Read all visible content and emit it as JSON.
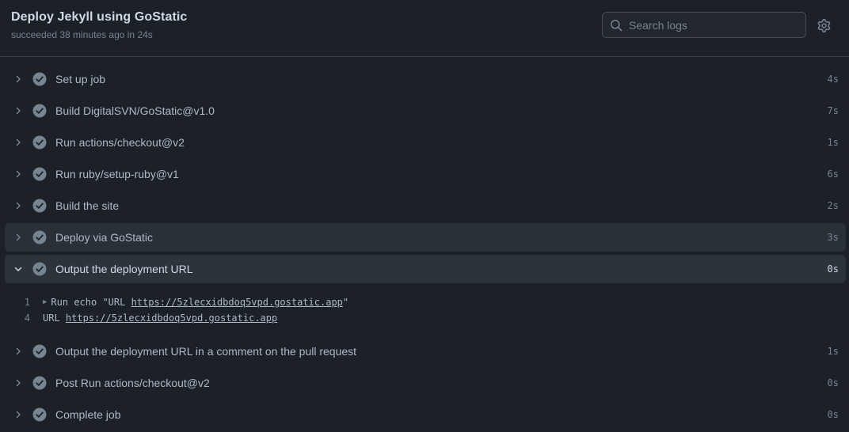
{
  "header": {
    "title": "Deploy Jekyll using GoStatic",
    "subtitle": "succeeded 38 minutes ago in 24s",
    "search_placeholder": "Search logs"
  },
  "colors": {
    "success": "#768390",
    "background": "#1c2128",
    "text": "#adbac7"
  },
  "steps_before": [
    {
      "name": "Set up job",
      "duration": "4s"
    },
    {
      "name": "Build DigitalSVN/GoStatic@v1.0",
      "duration": "7s"
    },
    {
      "name": "Run actions/checkout@v2",
      "duration": "1s"
    },
    {
      "name": "Run ruby/setup-ruby@v1",
      "duration": "6s"
    },
    {
      "name": "Build the site",
      "duration": "2s"
    },
    {
      "name": "Deploy via GoStatic",
      "duration": "3s"
    }
  ],
  "expanded_step": {
    "name": "Output the deployment URL",
    "duration": "0s",
    "log": [
      {
        "num": "1",
        "prefix": "Run echo \"URL ",
        "link": "https://5zlecxidbdoq5vpd.gostatic.app",
        "suffix": "\""
      },
      {
        "num": "4",
        "prefix": "URL ",
        "link": "https://5zlecxidbdoq5vpd.gostatic.app",
        "suffix": ""
      }
    ]
  },
  "steps_after": [
    {
      "name": "Output the deployment URL in a comment on the pull request",
      "duration": "1s"
    },
    {
      "name": "Post Run actions/checkout@v2",
      "duration": "0s"
    },
    {
      "name": "Complete job",
      "duration": "0s"
    }
  ]
}
